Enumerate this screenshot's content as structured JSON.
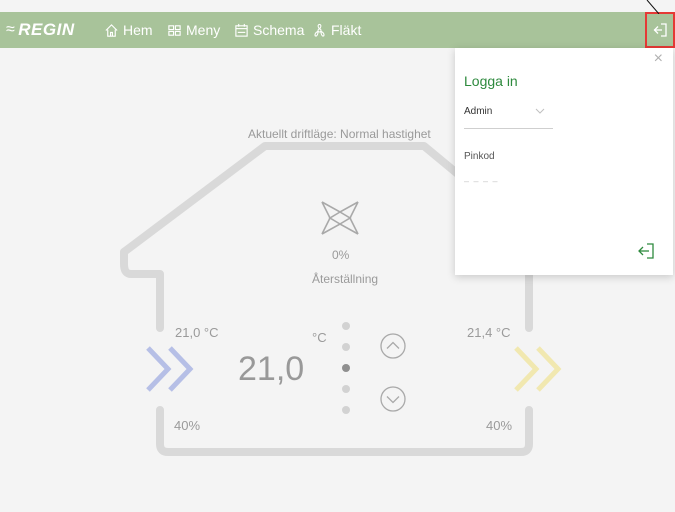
{
  "topbar": {
    "brand": "REGIN",
    "nav": [
      {
        "label": "Hem",
        "icon": "home-icon"
      },
      {
        "label": "Meny",
        "icon": "grid-menu-icon"
      },
      {
        "label": "Schema",
        "icon": "calendar-icon"
      },
      {
        "label": "Fläkt",
        "icon": "fan-icon"
      }
    ],
    "login_icon": "login-icon"
  },
  "status": {
    "operating_mode_text": "Aktuellt driftläge: Normal hastighet",
    "fan_percent": "0%",
    "mode_label": "Återställning"
  },
  "climate": {
    "supply_temp": "21,0 °C",
    "extract_temp": "21,4 °C",
    "supply_humidity": "40%",
    "extract_humidity": "40%",
    "setpoint": "21,0",
    "setpoint_unit": "°C",
    "setpoint_step_count": 5,
    "setpoint_step_active": 2
  },
  "login_panel": {
    "close_label": "×",
    "title": "Logga in",
    "user": {
      "value": "Admin"
    },
    "pin": {
      "label": "Pinkod",
      "placeholder": "– – – –"
    }
  },
  "colors": {
    "topbar": "#a8c39a",
    "accent_green": "#2e8a3e",
    "supply_arrow": "#b6bfe6",
    "extract_arrow": "#f1e8b0",
    "highlight": "#e53935"
  }
}
